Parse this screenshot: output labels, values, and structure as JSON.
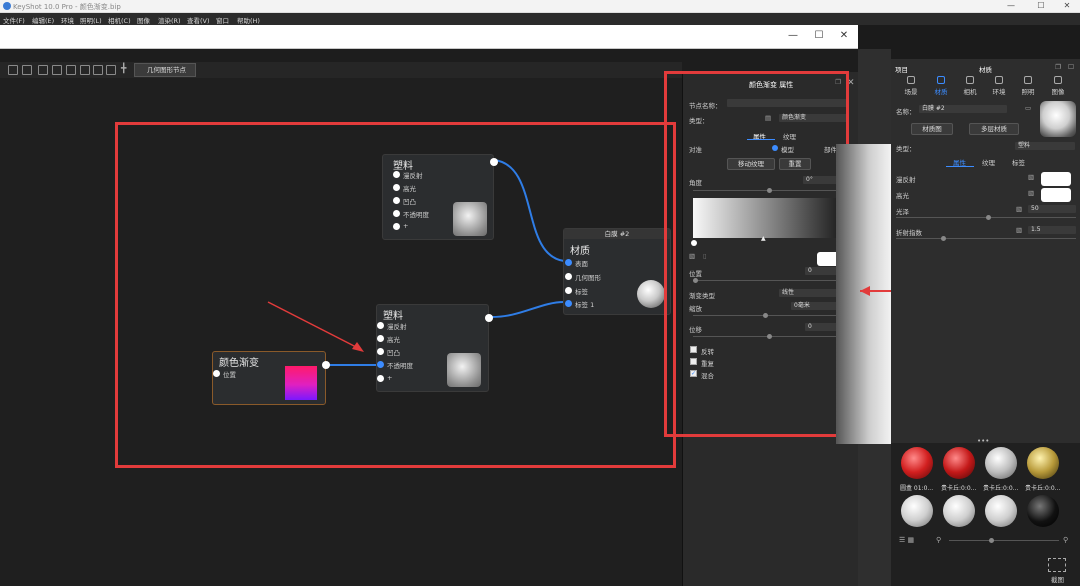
{
  "app": {
    "title": "KeyShot 10.0 Pro - 颜色渐变.bip"
  },
  "menu": [
    "文件(F)",
    "编辑(E)",
    "环境",
    "照明(L)",
    "相机(C)",
    "图像",
    "渲染(R)",
    "查看(V)",
    "窗口",
    "帮助(H)"
  ],
  "window2": {
    "min": "—",
    "max": "☐",
    "close": "✕"
  },
  "toolbar": {
    "geometry_node_button": "几何图形节点"
  },
  "nodes": {
    "plastic_top": {
      "title": "塑料",
      "ports": [
        "漫反射",
        "高光",
        "凹凸",
        "不透明度",
        "+"
      ]
    },
    "plastic_bottom": {
      "title": "塑料",
      "ports": [
        "漫反射",
        "高光",
        "凹凸",
        "不透明度",
        "+"
      ]
    },
    "gradient": {
      "title": "颜色渐变",
      "ports": [
        "位置"
      ]
    },
    "material": {
      "header": "白膜 #2",
      "title": "材质",
      "ports": [
        "表面",
        "几何图形",
        "标签",
        "标签 1"
      ]
    }
  },
  "props": {
    "title": "颜色渐变 属性",
    "node_name_label": "节点名称：",
    "node_name_value": "",
    "type_label": "类型：",
    "type_value": "颜色渐变",
    "tabs": [
      "属性",
      "纹理"
    ],
    "project_label": "对准",
    "project_options": [
      "模型",
      "部件"
    ],
    "move_texture_btn": "移动纹理",
    "reset_btn": "重置",
    "angle_label": "角度",
    "angle_value": "0°",
    "position_label": "位置",
    "position_value": "0",
    "interp_label": "渐变类型",
    "interp_value": "线性",
    "scale_label": "缩放",
    "scale_value": "0毫米",
    "offset_label": "位移",
    "offset_value": "0",
    "checkbox_invert": "反转",
    "checkbox_repeat": "重复",
    "checkbox_mix": "混合"
  },
  "dock": {
    "header_left": "项目",
    "header_center": "材质",
    "tabs": [
      "场景",
      "材质",
      "相机",
      "环境",
      "照明",
      "图像"
    ],
    "name_label": "名称：",
    "name_value": "白膜 #2",
    "material_graph_btn": "材质图",
    "multi_layer_btn": "多层材质",
    "type_label": "类型：",
    "type_value": "塑料",
    "sub_tabs": [
      "属性",
      "纹理",
      "标签"
    ],
    "diffuse_label": "漫反射",
    "specular_label": "高光",
    "roughness_label": "光泽",
    "roughness_value": "50",
    "refraction_label": "折射指数",
    "refraction_value": "1.5",
    "library_labels": [
      "圆盒 01:0...",
      "贵卡丘:0:0...",
      "贵卡丘:0:0...",
      "贵卡丘:0:0..."
    ],
    "bottom_label": "截图"
  },
  "colors": {
    "accent": "#3c8cff",
    "highlight": "#e23b3b"
  }
}
